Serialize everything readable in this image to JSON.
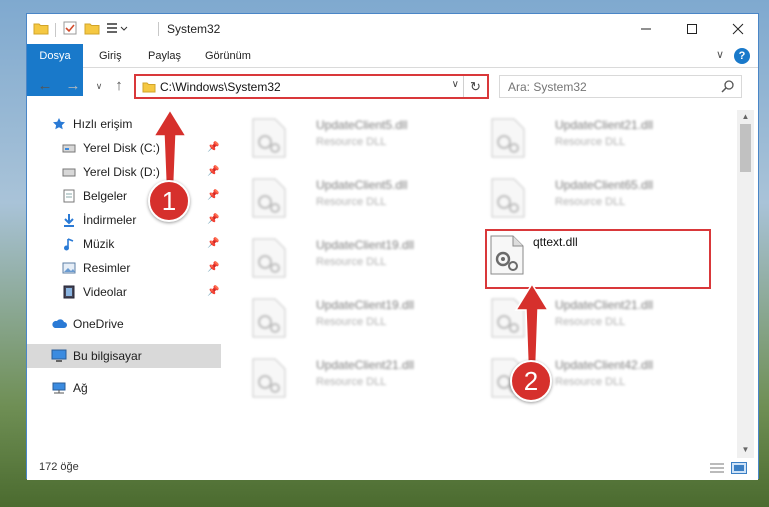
{
  "window": {
    "title": "System32"
  },
  "ribbon": {
    "tabs": [
      "Dosya",
      "Giriş",
      "Paylaş",
      "Görünüm"
    ]
  },
  "navbar": {
    "address": "C:\\Windows\\System32",
    "search_placeholder": "Ara: System32"
  },
  "sidebar": {
    "items": [
      {
        "label": "Hızlı erişim",
        "icon": "star-icon"
      },
      {
        "label": "Yerel Disk (C:)",
        "icon": "drive-icon"
      },
      {
        "label": "Yerel Disk (D:)",
        "icon": "drive-icon"
      },
      {
        "label": "Belgeler",
        "icon": "document-icon"
      },
      {
        "label": "İndirmeler",
        "icon": "download-icon"
      },
      {
        "label": "Müzik",
        "icon": "music-icon"
      },
      {
        "label": "Resimler",
        "icon": "pictures-icon"
      },
      {
        "label": "Videolar",
        "icon": "video-icon"
      },
      {
        "label": "OneDrive",
        "icon": "cloud-icon"
      },
      {
        "label": "Bu bilgisayar",
        "icon": "computer-icon"
      },
      {
        "label": "Ağ",
        "icon": "network-icon"
      }
    ]
  },
  "files": [
    {
      "name": "UpdateClient5.dll",
      "type": "Resource DLL"
    },
    {
      "name": "UpdateClient21.dll",
      "type": "Resource DLL"
    },
    {
      "name": "UpdateClient5.dll",
      "type": "Resource DLL"
    },
    {
      "name": "UpdateClient65.dll",
      "type": "Resource DLL"
    },
    {
      "name": "UpdateClient19.dll",
      "type": "Resource DLL"
    },
    {
      "name": "qttext.dll",
      "type": ""
    },
    {
      "name": "UpdateClient19.dll",
      "type": "Resource DLL"
    },
    {
      "name": "UpdateClient21.dll",
      "type": "Resource DLL"
    },
    {
      "name": "UpdateClient21.dll",
      "type": "Resource DLL"
    },
    {
      "name": "UpdateClient42.dll",
      "type": "Resource DLL"
    }
  ],
  "status": {
    "count": "172 öğe"
  },
  "annotations": {
    "step1": "1",
    "step2": "2",
    "color": "#d6302c"
  }
}
